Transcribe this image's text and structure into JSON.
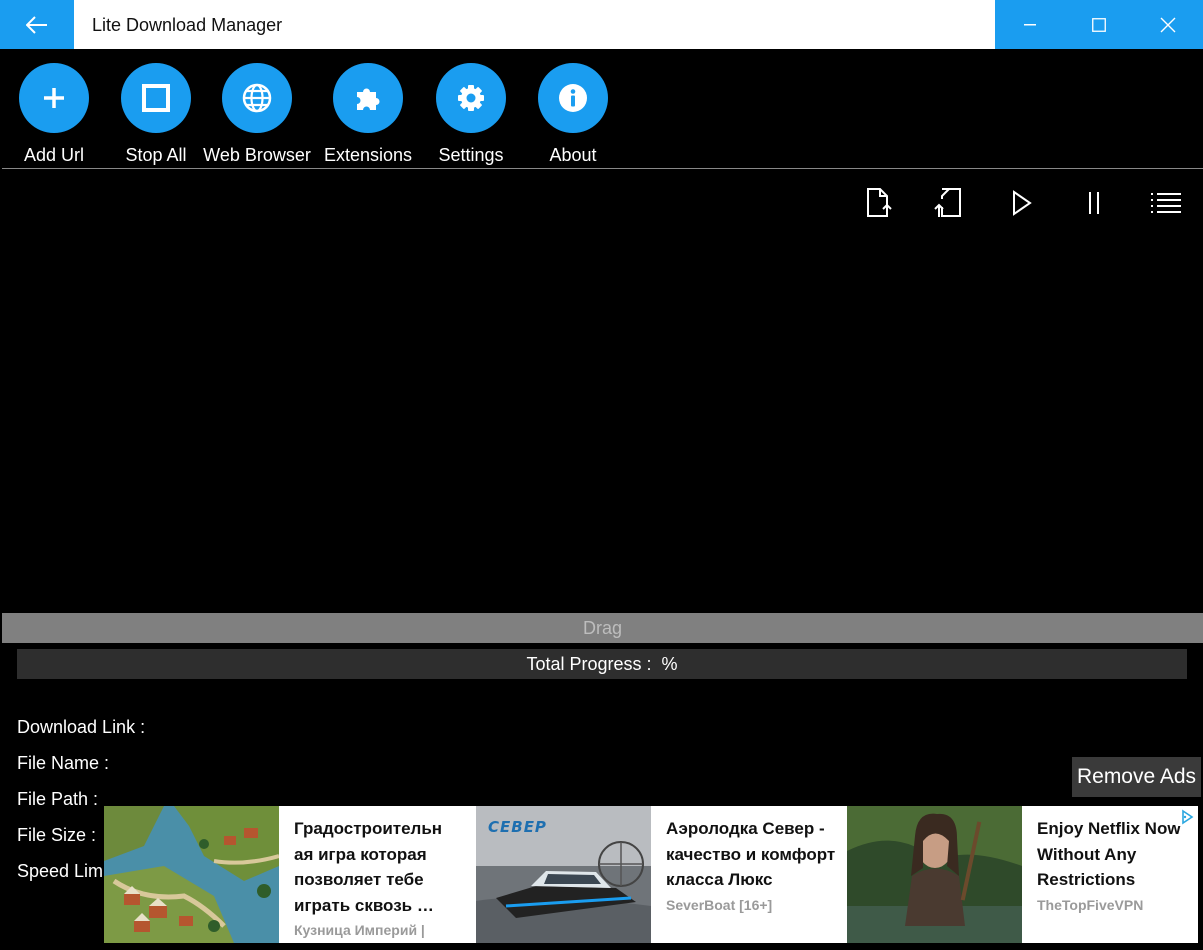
{
  "window": {
    "title": "Lite Download Manager"
  },
  "toolbar": {
    "items": [
      {
        "label": "Add Url",
        "icon": "plus-icon"
      },
      {
        "label": "Stop All",
        "icon": "stop-icon"
      },
      {
        "label": "Web Browser",
        "icon": "globe-icon"
      },
      {
        "label": "Extensions",
        "icon": "puzzle-icon"
      },
      {
        "label": "Settings",
        "icon": "gear-icon"
      },
      {
        "label": "About",
        "icon": "info-icon"
      }
    ]
  },
  "actions": [
    "export-file-icon",
    "import-file-icon",
    "play-icon",
    "pause-icon",
    "list-icon"
  ],
  "drag": {
    "label": "Drag"
  },
  "progress": {
    "label": "Total Progress :  %",
    "value": 0
  },
  "details": {
    "download_link": "Download Link :",
    "file_name": "File Name :",
    "file_path": "File Path :",
    "file_size": "File Size :",
    "speed_limit": "Speed Limi"
  },
  "ads": {
    "remove_label": "Remove Ads",
    "cards": [
      {
        "title": "Градостроительн ая игра которая позволяет тебе играть сквозь …",
        "source": "Кузница Империй |"
      },
      {
        "title": "Аэролодка Север - качество и комфорт класса Люкс",
        "source": "SeverBoat [16+]",
        "logo_text": "СЕВЕР"
      },
      {
        "title": "Enjoy Netflix Now Without Any Restrictions",
        "source": "TheTopFiveVPN"
      }
    ]
  },
  "colors": {
    "accent": "#1a9df0",
    "background": "#000000",
    "drag_bar": "#808080",
    "progress_track": "#2e2e2e"
  }
}
